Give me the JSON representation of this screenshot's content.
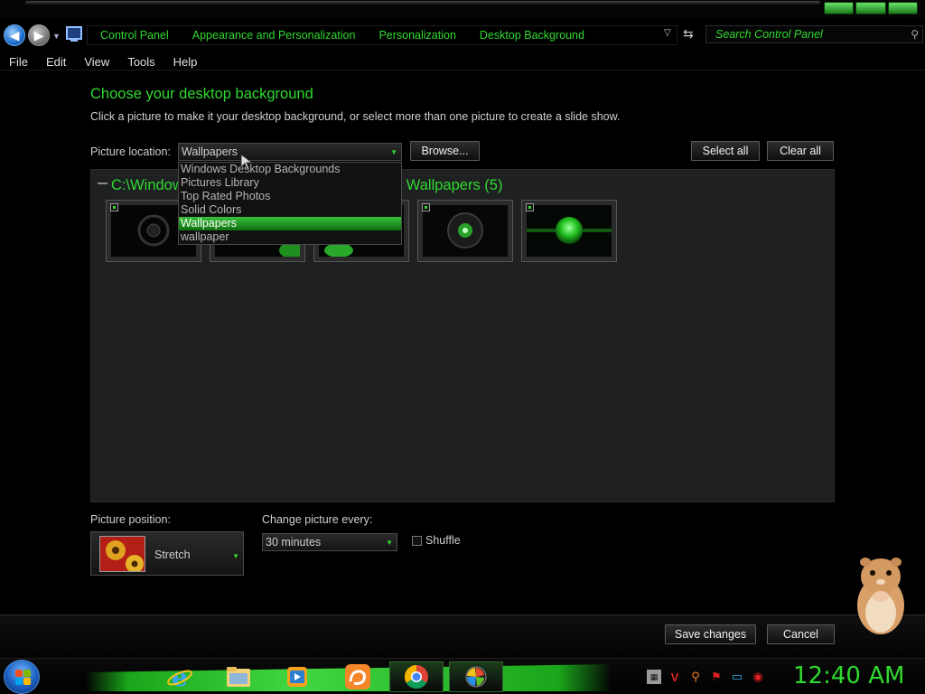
{
  "address": {
    "crumbs": [
      "Control Panel",
      "Appearance and Personalization",
      "Personalization",
      "Desktop Background"
    ],
    "search_placeholder": "Search Control Panel"
  },
  "menu": [
    "File",
    "Edit",
    "View",
    "Tools",
    "Help"
  ],
  "page": {
    "title": "Choose your desktop background",
    "description": "Click a picture to make it your desktop background, or select more than one picture to create a slide show."
  },
  "location": {
    "label": "Picture location:",
    "value": "Wallpapers",
    "options": [
      "Windows Desktop Backgrounds",
      "Pictures Library",
      "Top Rated Photos",
      "Solid Colors",
      "Wallpapers",
      "wallpaper"
    ],
    "selected": "Wallpapers"
  },
  "buttons": {
    "browse": "Browse...",
    "select_all": "Select all",
    "clear_all": "Clear all",
    "save": "Save changes",
    "cancel": "Cancel"
  },
  "gallery": {
    "group_header": "C:\\Windows\\Web\\Wallpapers (5)",
    "group_header_prefix": "C:\\Window",
    "group_header_suffix": "Wallpapers (5)",
    "thumbnails": [
      {
        "name": "wallpaper-1",
        "checked": true
      },
      {
        "name": "wallpaper-2",
        "checked": true
      },
      {
        "name": "wallpaper-3",
        "checked": true
      },
      {
        "name": "wallpaper-4",
        "checked": true
      },
      {
        "name": "wallpaper-5",
        "checked": true
      }
    ]
  },
  "position": {
    "label": "Picture position:",
    "value": "Stretch"
  },
  "interval": {
    "label": "Change picture every:",
    "value": "30 minutes"
  },
  "shuffle": {
    "label": "Shuffle",
    "checked": false
  },
  "taskbar": {
    "apps": [
      "internet-explorer",
      "file-explorer",
      "media-player",
      "uc-browser",
      "chrome",
      "personalization"
    ],
    "clock": "12:40 AM"
  },
  "colors": {
    "accent": "#2fd92f",
    "background": "#000000",
    "selected_option": "#1ea51e"
  }
}
